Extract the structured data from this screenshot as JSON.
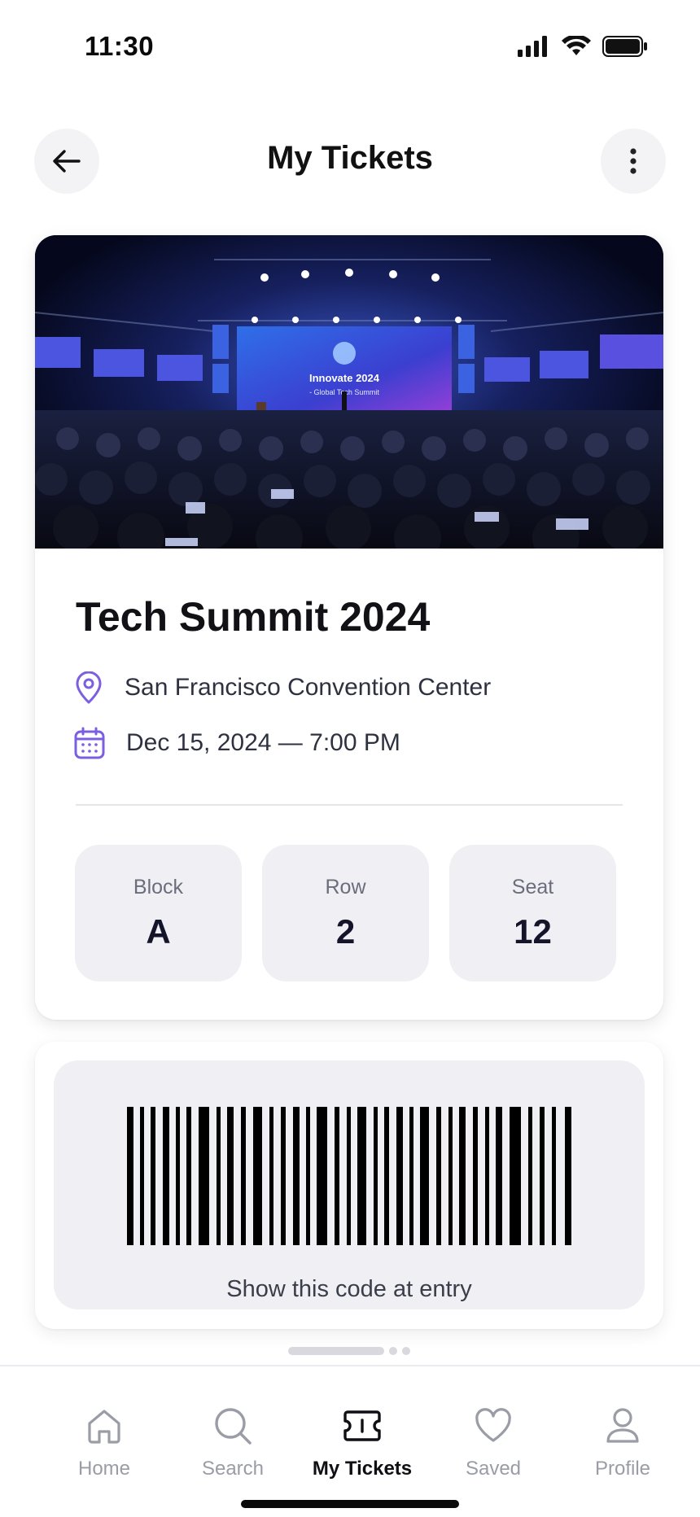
{
  "status_bar": {
    "time": "11:30"
  },
  "header": {
    "title": "My Tickets"
  },
  "ticket": {
    "event_title": "Tech Summit 2024",
    "location": "San Francisco Convention Center",
    "datetime": "Dec 15, 2024 — 7:00 PM",
    "image_text": {
      "headline": "Innovate 2024",
      "subheadline": "- Global Tech Summit"
    },
    "seating": [
      {
        "label": "Block",
        "value": "A"
      },
      {
        "label": "Row",
        "value": "2"
      },
      {
        "label": "Seat",
        "value": "12"
      }
    ]
  },
  "barcode": {
    "caption": "Show this code at entry"
  },
  "tabs": [
    {
      "label": "Home",
      "icon": "home-icon",
      "active": false
    },
    {
      "label": "Search",
      "icon": "search-icon",
      "active": false
    },
    {
      "label": "My Tickets",
      "icon": "ticket-icon",
      "active": true
    },
    {
      "label": "Saved",
      "icon": "heart-icon",
      "active": false
    },
    {
      "label": "Profile",
      "icon": "user-icon",
      "active": false
    }
  ],
  "colors": {
    "accent": "#7c5fe0",
    "chip_bg": "#f0f0f4",
    "text_primary": "#111116",
    "text_muted": "#9a9ca6"
  }
}
